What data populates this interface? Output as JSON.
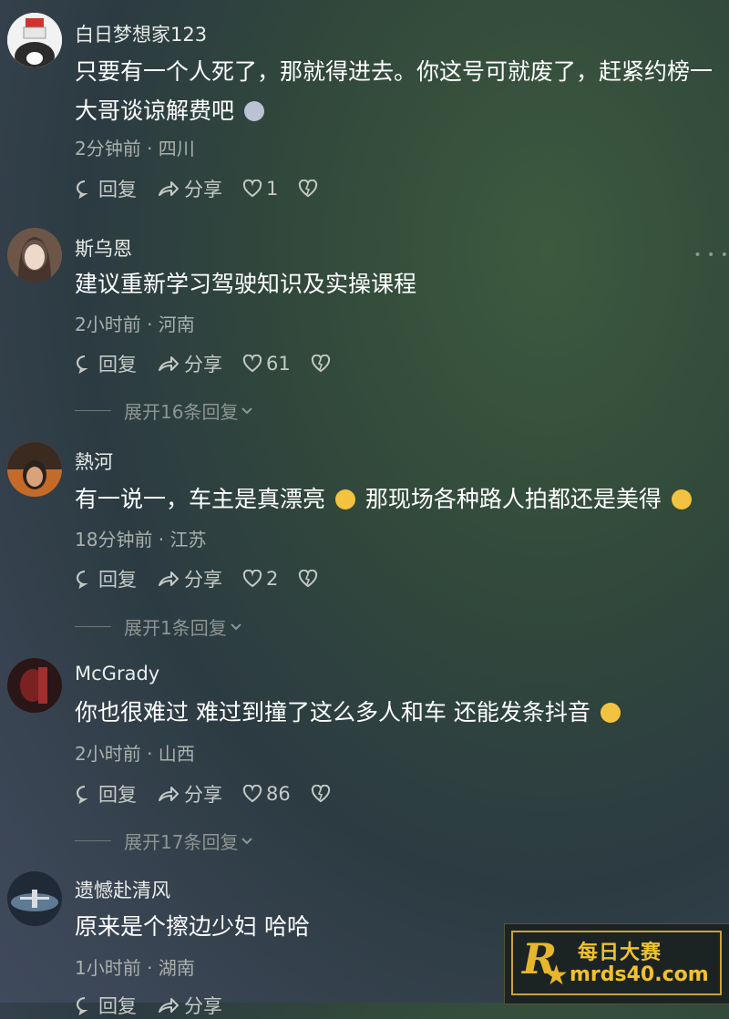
{
  "comments": [
    {
      "username": "白日梦想家123",
      "text": "只要有一个人死了，那就得进去。你这号可就废了，赶紧约榜一大哥谈谅解费吧",
      "emoji": "cat-emoji",
      "meta": "2分钟前 · 四川",
      "reply_label": "回复",
      "share_label": "分享",
      "likes": "1",
      "expand": ""
    },
    {
      "username": "斯乌恩",
      "text": "建议重新学习驾驶知识及实操课程",
      "meta": "2小时前 · 河南",
      "reply_label": "回复",
      "share_label": "分享",
      "likes": "61",
      "expand": "展开16条回复"
    },
    {
      "username": "熱河",
      "text": "有一说一，车主是真漂亮",
      "text2": "那现场各种路人拍都还是美得",
      "emoji": "grin-emoji",
      "emoji2": "thinking-emoji",
      "meta": "18分钟前 · 江苏",
      "reply_label": "回复",
      "share_label": "分享",
      "likes": "2",
      "expand": "展开1条回复"
    },
    {
      "username": "McGrady",
      "text": "你也很难过 难过到撞了这么多人和车 还能发条抖音",
      "emoji": "smile-emoji",
      "meta": "2小时前 · 山西",
      "reply_label": "回复",
      "share_label": "分享",
      "likes": "86",
      "expand": "展开17条回复"
    },
    {
      "username": "遗憾赴清风",
      "text": "原来是个擦边少妇 哈哈",
      "meta": "1小时前 · 湖南",
      "reply_label": "回复",
      "share_label": "分享",
      "likes": "",
      "expand": ""
    }
  ],
  "watermark": {
    "cn": "每日大赛",
    "url": "mrds40.com",
    "small": "每日大赛"
  },
  "colors": {
    "accent": "#f0c22e",
    "text": "#ffffff",
    "meta": "#aab1ad"
  }
}
